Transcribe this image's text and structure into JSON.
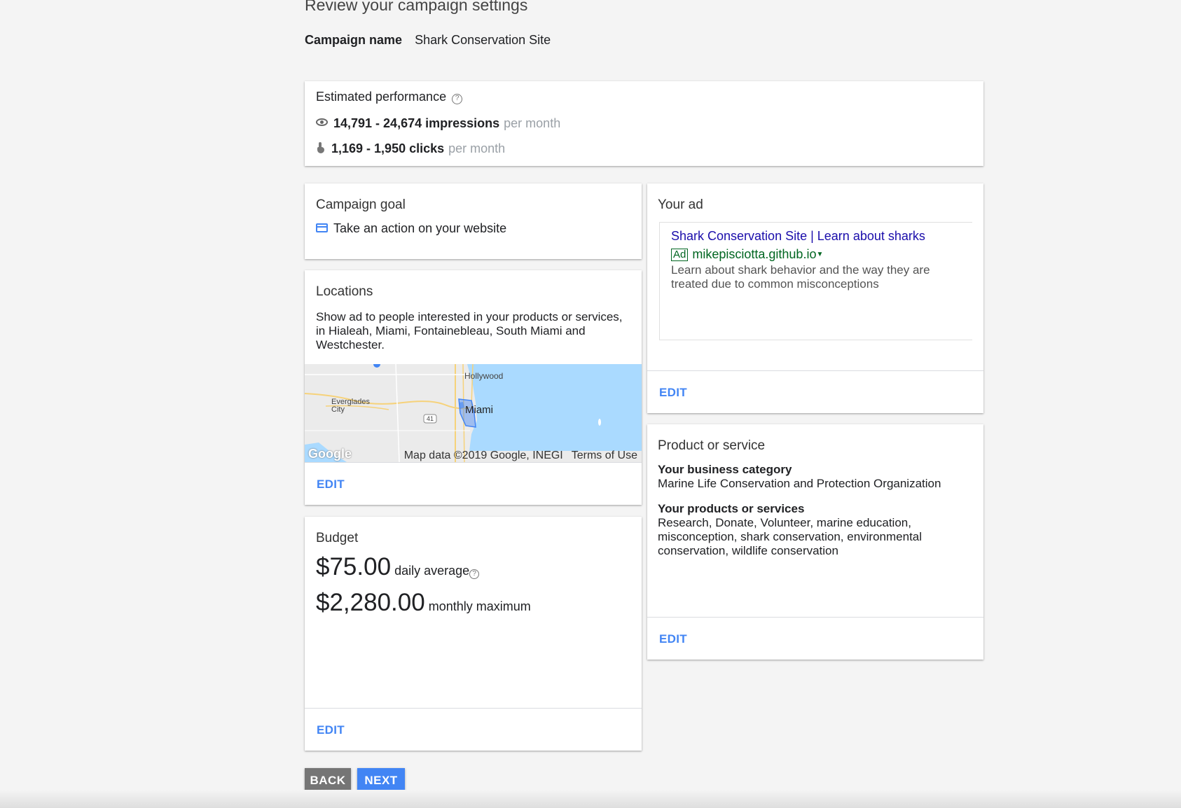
{
  "header": {
    "title": "Review your campaign settings",
    "campaign_name_label": "Campaign name",
    "campaign_name_value": "Shark Conservation Site"
  },
  "performance": {
    "title": "Estimated performance",
    "help_icon": "help-circle-icon",
    "impressions": "14,791 - 24,674 impressions",
    "impressions_period": "per month",
    "clicks": "1,169 - 1,950 clicks",
    "clicks_period": "per month"
  },
  "goal": {
    "title": "Campaign goal",
    "value": "Take an action on your website",
    "icon": "web-page-icon"
  },
  "locations": {
    "title": "Locations",
    "description": "Show ad to people interested in your products or services, in Hialeah, Miami, Fontainebleau, South Miami and Westchester.",
    "map": {
      "label_hollywood": "Hollywood",
      "label_miami": "Miami",
      "label_everglades": "Everglades City",
      "label_route": "41",
      "logo": "Google",
      "credit": "Map data ©2019 Google, INEGI",
      "terms": "Terms of Use"
    },
    "edit": "EDIT"
  },
  "budget": {
    "title": "Budget",
    "daily_amount": "$75.00",
    "daily_label": "daily average",
    "monthly_amount": "$2,280.00",
    "monthly_label": "monthly maximum",
    "edit": "EDIT"
  },
  "ad": {
    "title": "Your ad",
    "headline": "Shark Conservation Site | Learn about sharks",
    "badge": "Ad",
    "url": "mikepisciotta.github.io",
    "description": "Learn about shark behavior and the way they are treated due to common misconceptions",
    "edit": "EDIT"
  },
  "product": {
    "title": "Product or service",
    "category_heading": "Your business category",
    "category_value": "Marine Life Conservation and Protection Organization",
    "products_heading": "Your products or services",
    "products_value": "Research, Donate, Volunteer, marine education, misconception, shark conservation, environmental conservation, wildlife conservation",
    "edit": "EDIT"
  },
  "actions": {
    "back": "BACK",
    "next": "NEXT"
  },
  "colors": {
    "accent": "#4285f4",
    "ad_headline": "#1a0dab",
    "ad_url": "#006621",
    "back_button": "#757575"
  }
}
